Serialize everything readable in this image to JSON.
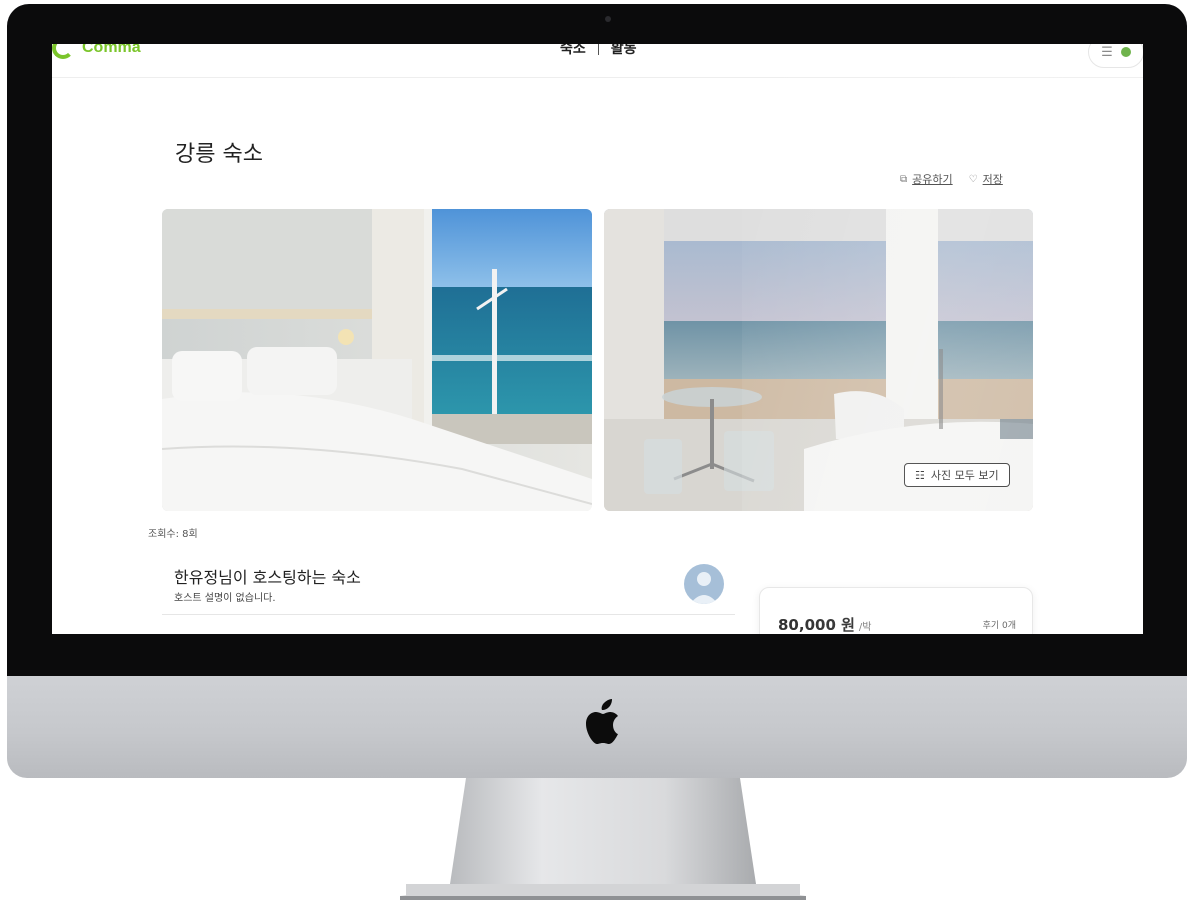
{
  "header": {
    "logo_text": "Comma",
    "nav": [
      "숙소",
      "활동"
    ],
    "menu_icon": "hamburger-icon",
    "accent_color": "#7bc52b"
  },
  "listing": {
    "title": "강릉 숙소",
    "share_label": "공유하기",
    "save_label": "저장",
    "show_all_photos_label": "사진 모두 보기",
    "views_label": "조회수: 8회"
  },
  "host": {
    "title": "한유정님이 호스팅하는 숙소",
    "description": "호스트 설명이 없습니다."
  },
  "booking": {
    "price": "80,000 원",
    "unit": "/박",
    "reviews": "후기 0개"
  }
}
